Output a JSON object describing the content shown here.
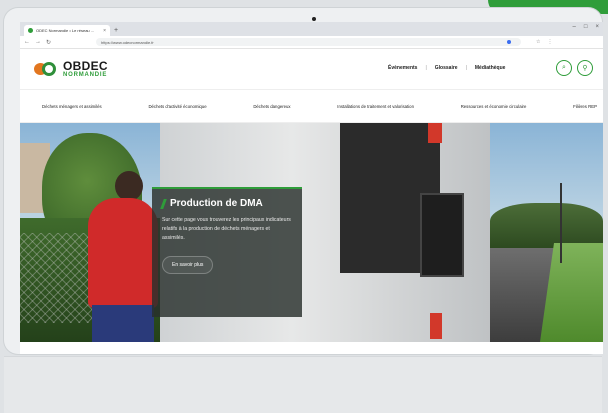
{
  "browser": {
    "tab_title": "ODEC Normandie • Le réseau ...",
    "tab_close": "×",
    "new_tab": "+",
    "url": "https://www.odecnormandie.fr",
    "window_controls": [
      "–",
      "□",
      "×"
    ]
  },
  "site": {
    "logo_line1": "OBDEC",
    "logo_line2": "NORMANDIE",
    "header_links": [
      "Évènements",
      "Glossaire",
      "Médiathèque"
    ],
    "nav": [
      "Déchets ménagers et assimilés",
      "Déchets d'activité économique",
      "Déchets dangereux",
      "Installations de traitement et valorisation",
      "Ressources et économie circulaire",
      "Filières REP"
    ]
  },
  "hero": {
    "title": "Production de DMA",
    "description": "Sur cette page vous trouverez les principaux indicateurs relatifs à la production de déchets ménagers et assimilés.",
    "button": "En savoir plus"
  },
  "colors": {
    "brand_green": "#2f9d3a",
    "brand_orange": "#e2761f"
  }
}
